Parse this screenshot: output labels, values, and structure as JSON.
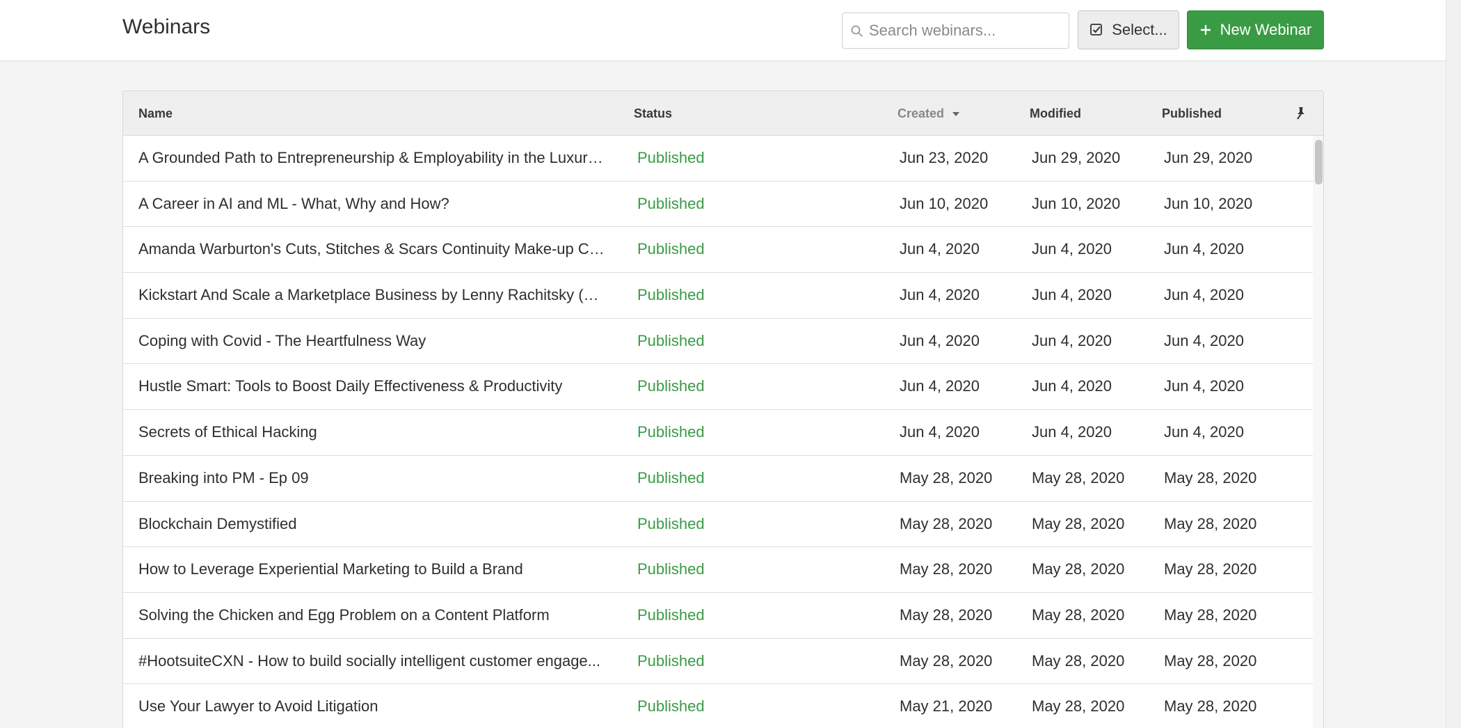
{
  "header": {
    "title": "Webinars",
    "search_placeholder": "Search webinars...",
    "select_label": "Select...",
    "new_label": "New Webinar"
  },
  "table": {
    "columns": {
      "name": "Name",
      "status": "Status",
      "created": "Created",
      "modified": "Modified",
      "published": "Published"
    },
    "sorted_column": "created",
    "rows": [
      {
        "name": "A Grounded Path to Entrepreneurship & Employability in the Luxury ...",
        "status": "Published",
        "created": "Jun 23, 2020",
        "modified": "Jun 29, 2020",
        "published": "Jun 29, 2020"
      },
      {
        "name": "A Career in AI and ML - What, Why and How?",
        "status": "Published",
        "created": "Jun 10, 2020",
        "modified": "Jun 10, 2020",
        "published": "Jun 10, 2020"
      },
      {
        "name": "Amanda Warburton's Cuts, Stitches & Scars Continuity Make-up Cla...",
        "status": "Published",
        "created": "Jun 4, 2020",
        "modified": "Jun 4, 2020",
        "published": "Jun 4, 2020"
      },
      {
        "name": "Kickstart And Scale a Marketplace Business by Lenny Rachitsky (Ai...",
        "status": "Published",
        "created": "Jun 4, 2020",
        "modified": "Jun 4, 2020",
        "published": "Jun 4, 2020"
      },
      {
        "name": "Coping with Covid - The Heartfulness Way",
        "status": "Published",
        "created": "Jun 4, 2020",
        "modified": "Jun 4, 2020",
        "published": "Jun 4, 2020"
      },
      {
        "name": "Hustle Smart: Tools to Boost Daily Effectiveness & Productivity",
        "status": "Published",
        "created": "Jun 4, 2020",
        "modified": "Jun 4, 2020",
        "published": "Jun 4, 2020"
      },
      {
        "name": "Secrets of Ethical Hacking",
        "status": "Published",
        "created": "Jun 4, 2020",
        "modified": "Jun 4, 2020",
        "published": "Jun 4, 2020"
      },
      {
        "name": "Breaking into PM - Ep 09",
        "status": "Published",
        "created": "May 28, 2020",
        "modified": "May 28, 2020",
        "published": "May 28, 2020"
      },
      {
        "name": "Blockchain Demystified",
        "status": "Published",
        "created": "May 28, 2020",
        "modified": "May 28, 2020",
        "published": "May 28, 2020"
      },
      {
        "name": "How to Leverage Experiential Marketing to Build a Brand",
        "status": "Published",
        "created": "May 28, 2020",
        "modified": "May 28, 2020",
        "published": "May 28, 2020"
      },
      {
        "name": "Solving the Chicken and Egg Problem on a Content Platform",
        "status": "Published",
        "created": "May 28, 2020",
        "modified": "May 28, 2020",
        "published": "May 28, 2020"
      },
      {
        "name": "#HootsuiteCXN - How to build socially intelligent customer engage...",
        "status": "Published",
        "created": "May 28, 2020",
        "modified": "May 28, 2020",
        "published": "May 28, 2020"
      },
      {
        "name": "Use Your Lawyer to Avoid Litigation",
        "status": "Published",
        "created": "May 21, 2020",
        "modified": "May 28, 2020",
        "published": "May 28, 2020"
      }
    ]
  },
  "colors": {
    "accent_green": "#3a9b45",
    "header_bg": "#ffffff",
    "page_bg": "#f4f4f4"
  },
  "icons": {
    "search": "search-icon",
    "select": "checkbox-icon",
    "new": "plus-icon",
    "sort": "caret-down-icon",
    "pin": "pin-icon"
  }
}
